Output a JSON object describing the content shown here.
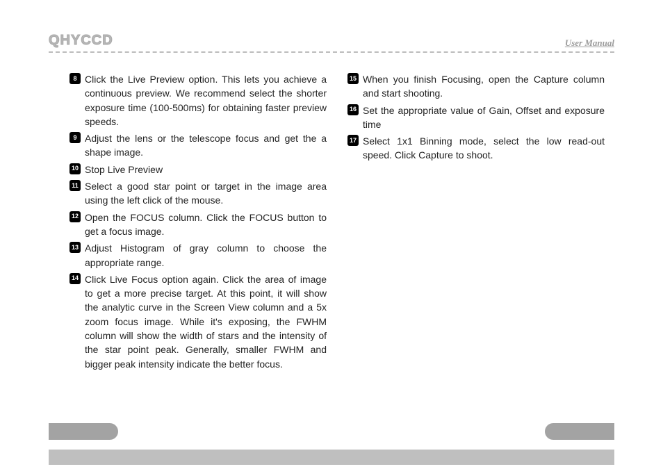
{
  "header": {
    "logo": "QHYCCD",
    "manual_label": "User Manual"
  },
  "left_items": [
    {
      "num": "8",
      "text": "Click the Live Preview option. This lets you achieve a continuous preview.  We recommend select the shorter exposure time (100-500ms) for obtaining faster preview speeds."
    },
    {
      "num": "9",
      "text": "Adjust the lens or the telescope focus and get the a shape image."
    },
    {
      "num": "10",
      "text": "Stop Live Preview"
    },
    {
      "num": "11",
      "text": "Select a good star point or target in the image area using the left click of the mouse."
    },
    {
      "num": "12",
      "text": "Open the FOCUS column.  Click the FOCUS button to get a focus image."
    },
    {
      "num": "13",
      "text": "Adjust Histogram of gray column to choose the appropriate range."
    },
    {
      "num": "14",
      "text": "Click Live Focus option again. Click the area of image to get a more precise target. At this point, it will show the analytic curve in the Screen View column and a 5x zoom focus image. While it's exposing, the FWHM column will show the width of stars and the intensity of the star point peak. Generally, smaller FWHM and bigger peak intensity indicate the better focus."
    }
  ],
  "right_items": [
    {
      "num": "15",
      "text": "When you finish Focusing, open the Capture column and start shooting."
    },
    {
      "num": "16",
      "text": "Set the appropriate value of Gain, Offset and exposure time"
    },
    {
      "num": "17",
      "text": "Select 1x1 Binning mode, select the low read-out speed.  Click Capture to shoot."
    }
  ]
}
